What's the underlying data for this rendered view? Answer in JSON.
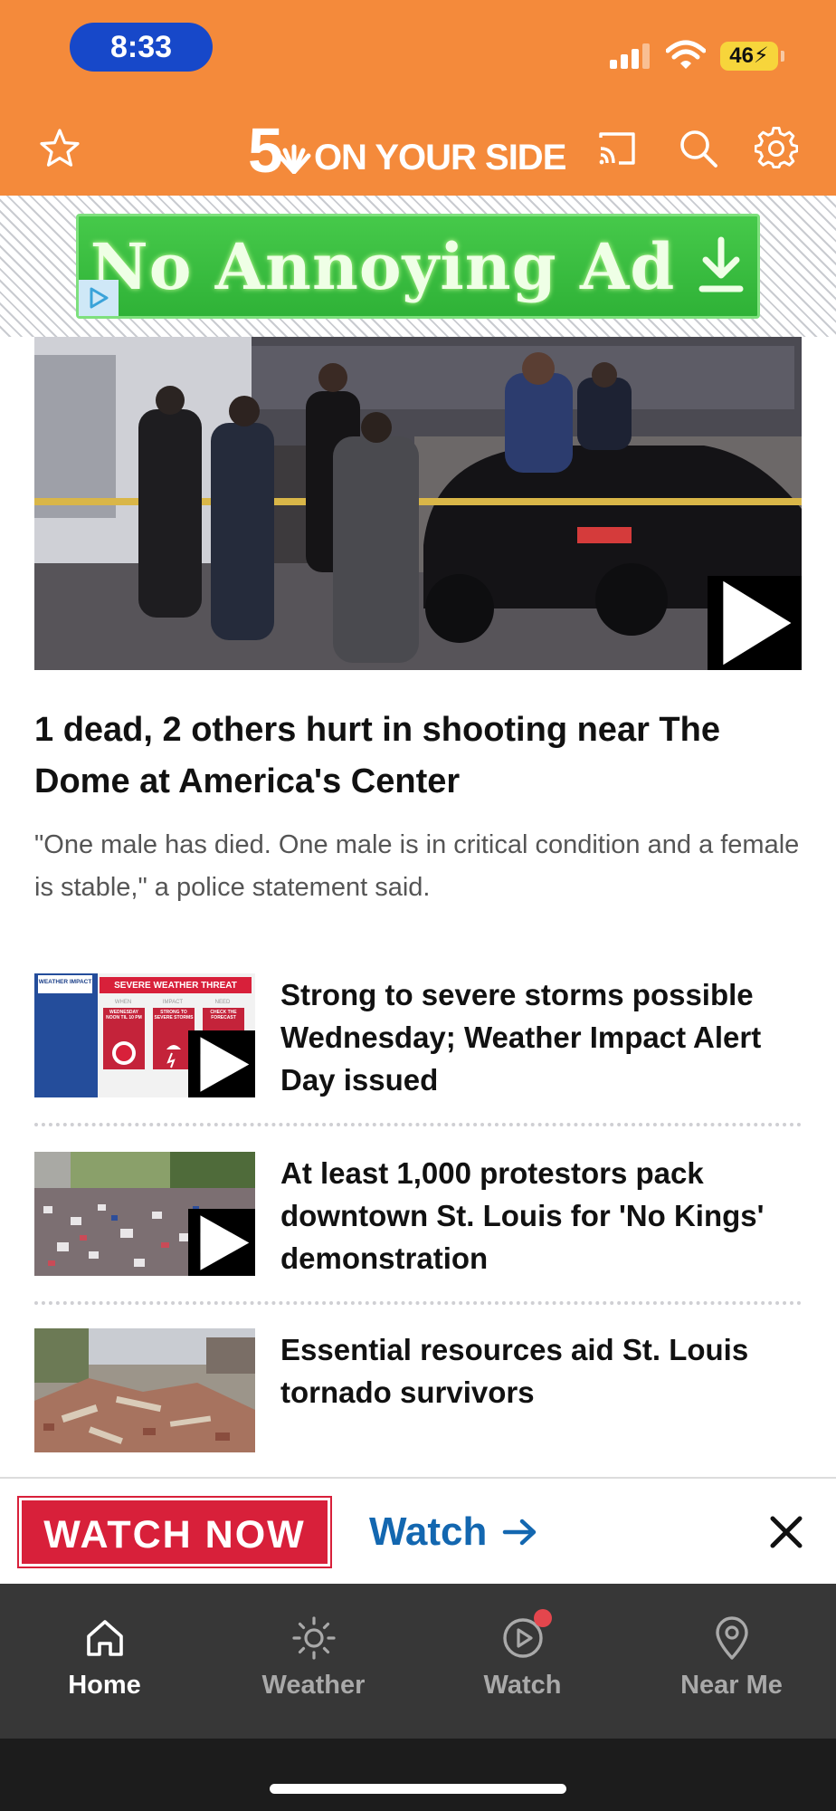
{
  "status_bar": {
    "time": "8:33",
    "battery": "46"
  },
  "header": {
    "logo_number": "5",
    "logo_text": "ON YOUR SIDE",
    "brand_color": "#f48a3b"
  },
  "ad": {
    "text": "No Annoying Ad"
  },
  "hero": {
    "headline": "1 dead, 2 others hurt in shooting near The Dome at America's Center",
    "summary": "\"One male has died. One male is in critical condition and a female is stable,\" a police statement said."
  },
  "stories": [
    {
      "title": "Strong to severe storms possible Wednesday; Weather Impact Alert Day issued",
      "has_video": true,
      "thumb": {
        "brand": "WEATHER IMPACT",
        "banner": "SEVERE WEATHER THREAT",
        "cols": [
          "WHEN",
          "IMPACT",
          "NEED"
        ],
        "cells": [
          "WEDNESDAY NOON TIL 10 PM",
          "STRONG TO SEVERE STORMS",
          "CHECK THE FORECAST"
        ]
      }
    },
    {
      "title": "At least 1,000 protestors pack downtown St. Louis for 'No Kings' demonstration",
      "has_video": true
    },
    {
      "title": "Essential resources aid St. Louis tornado survivors",
      "has_video": false
    }
  ],
  "watch_bar": {
    "watch_now": "WATCH NOW",
    "watch_link": "Watch",
    "accent": "#d8203a",
    "link_color": "#1367b0"
  },
  "tabs": [
    {
      "label": "Home",
      "icon": "home-icon",
      "active": true
    },
    {
      "label": "Weather",
      "icon": "sun-icon",
      "active": false
    },
    {
      "label": "Watch",
      "icon": "play-circle-icon",
      "active": false,
      "notification": true
    },
    {
      "label": "Near Me",
      "icon": "location-pin-icon",
      "active": false
    }
  ]
}
